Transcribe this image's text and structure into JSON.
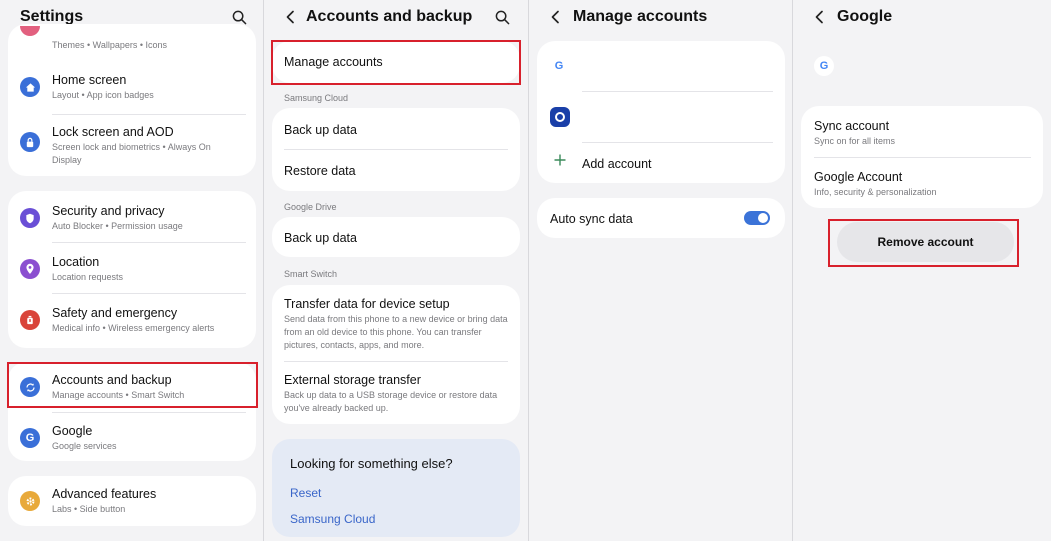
{
  "settings": {
    "title": "Settings",
    "partial_sub": "Themes • Wallpapers • Icons",
    "items": [
      {
        "title": "Home screen",
        "sub": "Layout • App icon badges"
      },
      {
        "title": "Lock screen and AOD",
        "sub": "Screen lock and biometrics • Always On Display"
      },
      {
        "title": "Security and privacy",
        "sub": "Auto Blocker • Permission usage"
      },
      {
        "title": "Location",
        "sub": "Location requests"
      },
      {
        "title": "Safety and emergency",
        "sub": "Medical info • Wireless emergency alerts"
      },
      {
        "title": "Accounts and backup",
        "sub": "Manage accounts • Smart Switch"
      },
      {
        "title": "Google",
        "sub": "Google services"
      },
      {
        "title": "Advanced features",
        "sub": "Labs • Side button"
      }
    ]
  },
  "accounts_backup": {
    "title": "Accounts and backup",
    "manage_accounts": "Manage accounts",
    "samsung_cloud_label": "Samsung Cloud",
    "back_up_data": "Back up data",
    "restore_data": "Restore data",
    "google_drive_label": "Google Drive",
    "drive_back_up_data": "Back up data",
    "smart_switch_label": "Smart Switch",
    "transfer_title": "Transfer data for device setup",
    "transfer_sub": "Send data from this phone to a new device or bring data from an old device to this phone. You can transfer pictures, contacts, apps, and more.",
    "external_title": "External storage transfer",
    "external_sub": "Back up data to a USB storage device or restore data you've already backed up.",
    "looking_title": "Looking for something else?",
    "link_reset": "Reset",
    "link_samsung_cloud": "Samsung Cloud"
  },
  "manage_accounts": {
    "title": "Manage accounts",
    "add_account": "Add account",
    "auto_sync": "Auto sync data",
    "auto_sync_on": true
  },
  "google": {
    "title": "Google",
    "sync_title": "Sync account",
    "sync_sub": "Sync on for all items",
    "ga_title": "Google Account",
    "ga_sub": "Info, security & personalization",
    "remove": "Remove account"
  },
  "colors": {
    "highlight": "#d8202c",
    "accent": "#3b73d8",
    "link": "#3a66c9"
  }
}
